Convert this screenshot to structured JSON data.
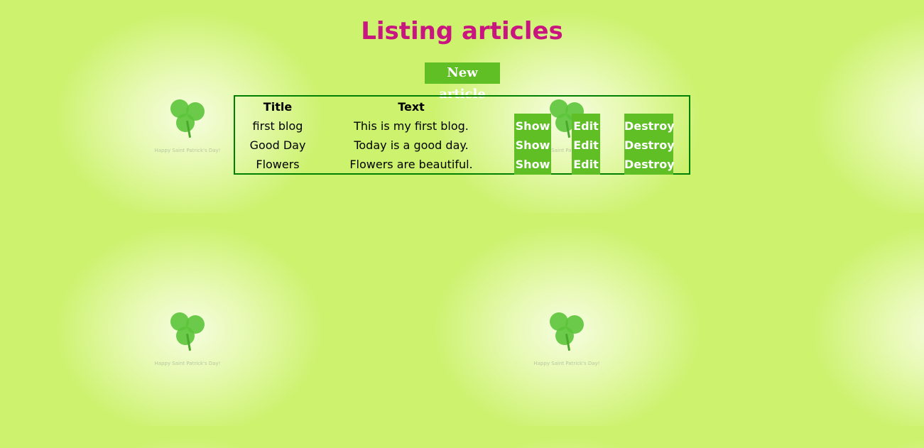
{
  "page": {
    "title": "Listing articles",
    "new_article": "New article",
    "watermark": "Happy Saint Patrick's Day!"
  },
  "table": {
    "headers": [
      "Title",
      "Text"
    ],
    "rows": [
      {
        "title": "first blog",
        "text": "This is my first blog.",
        "show": "Show",
        "edit": "Edit",
        "destroy": "Destroy"
      },
      {
        "title": "Good Day",
        "text": "Today is a good day.",
        "show": "Show",
        "edit": "Edit",
        "destroy": "Destroy"
      },
      {
        "title": "Flowers",
        "text": "Flowers are beautiful.",
        "show": "Show",
        "edit": "Edit",
        "destroy": "Destroy"
      }
    ]
  },
  "colors": {
    "title": "#c8157f",
    "button": "#5fbf25",
    "border": "#008000",
    "background": "#ccf26e"
  }
}
